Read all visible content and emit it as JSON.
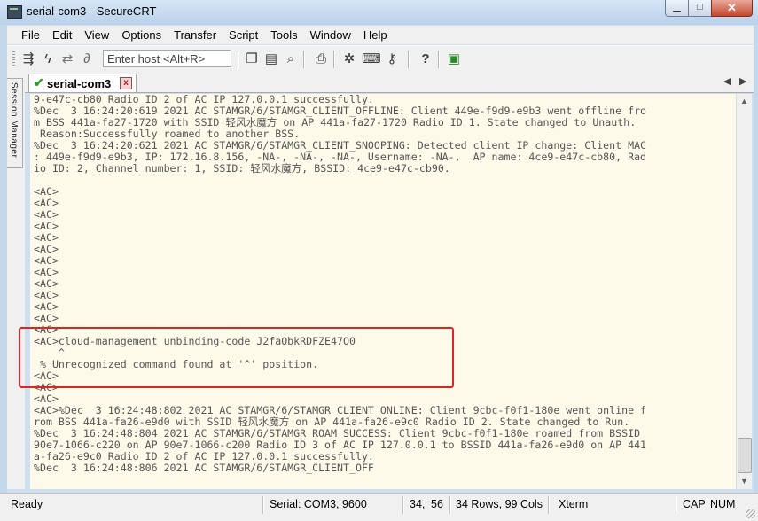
{
  "window": {
    "title": "serial-com3 - SecureCRT",
    "minimize_glyph": "▁",
    "maximize_glyph": "□",
    "close_glyph": "✕"
  },
  "menu": [
    "File",
    "Edit",
    "View",
    "Options",
    "Transfer",
    "Script",
    "Tools",
    "Window",
    "Help"
  ],
  "toolbar": {
    "host_placeholder": "Enter host <Alt+R>",
    "icons": [
      "connect-icon",
      "quick-connect-icon",
      "reconnect-icon",
      "disconnect-icon",
      "copy-icon",
      "paste-icon",
      "find-icon",
      "print-icon",
      "settings-icon",
      "keymap-icon",
      "keygen-icon",
      "help-icon",
      "options-icon"
    ]
  },
  "session_manager": {
    "label": "Session Manager"
  },
  "tab": {
    "label": "serial-com3",
    "close_glyph": "x",
    "prev_glyph": "◀",
    "next_glyph": "▶"
  },
  "terminal": {
    "lines": [
      "9-e47c-cb80 Radio ID 2 of AC IP 127.0.0.1 successfully.",
      "%Dec  3 16:24:20:619 2021 AC STAMGR/6/STAMGR_CLIENT_OFFLINE: Client 449e-f9d9-e9b3 went offline fro",
      "m BSS 441a-fa27-1720 with SSID 轻风水魔方 on AP 441a-fa27-1720 Radio ID 1. State changed to Unauth.",
      " Reason:Successfully roamed to another BSS.",
      "%Dec  3 16:24:20:621 2021 AC STAMGR/6/STAMGR_CLIENT_SNOOPING: Detected client IP change: Client MAC",
      ": 449e-f9d9-e9b3, IP: 172.16.8.156, -NA-, -NA-, -NA-, Username: -NA-,  AP name: 4ce9-e47c-cb80, Rad",
      "io ID: 2, Channel number: 1, SSID: 轻风水魔方, BSSID: 4ce9-e47c-cb90.",
      "",
      "<AC>",
      "<AC>",
      "<AC>",
      "<AC>",
      "<AC>",
      "<AC>",
      "<AC>",
      "<AC>",
      "<AC>",
      "<AC>",
      "<AC>",
      "<AC>",
      "<AC>",
      "<AC>cloud-management unbinding-code J2faObkRDFZE47O0",
      "    ^",
      " % Unrecognized command found at '^' position.",
      "<AC>",
      "<AC>",
      "<AC>",
      "<AC>%Dec  3 16:24:48:802 2021 AC STAMGR/6/STAMGR_CLIENT_ONLINE: Client 9cbc-f0f1-180e went online f",
      "rom BSS 441a-fa26-e9d0 with SSID 轻风水魔方 on AP 441a-fa26-e9c0 Radio ID 2. State changed to Run.",
      "%Dec  3 16:24:48:804 2021 AC STAMGR/6/STAMGR_ROAM_SUCCESS: Client 9cbc-f0f1-180e roamed from BSSID",
      "90e7-1066-c220 on AP 90e7-1066-c200 Radio ID 3 of AC IP 127.0.0.1 to BSSID 441a-fa26-e9d0 on AP 441",
      "a-fa26-e9c0 Radio ID 2 of AC IP 127.0.0.1 successfully.",
      "%Dec  3 16:24:48:806 2021 AC STAMGR/6/STAMGR_CLIENT_OFF"
    ]
  },
  "statusbar": {
    "ready": "Ready",
    "serial": "Serial: COM3, 9600",
    "row": "34,",
    "col": "56",
    "size": "34 Rows, 99 Cols",
    "term": "Xterm",
    "cap": "CAP",
    "num": "NUM"
  },
  "colors": {
    "terminal_bg": "#fdfaea",
    "highlight": "#e02424"
  }
}
